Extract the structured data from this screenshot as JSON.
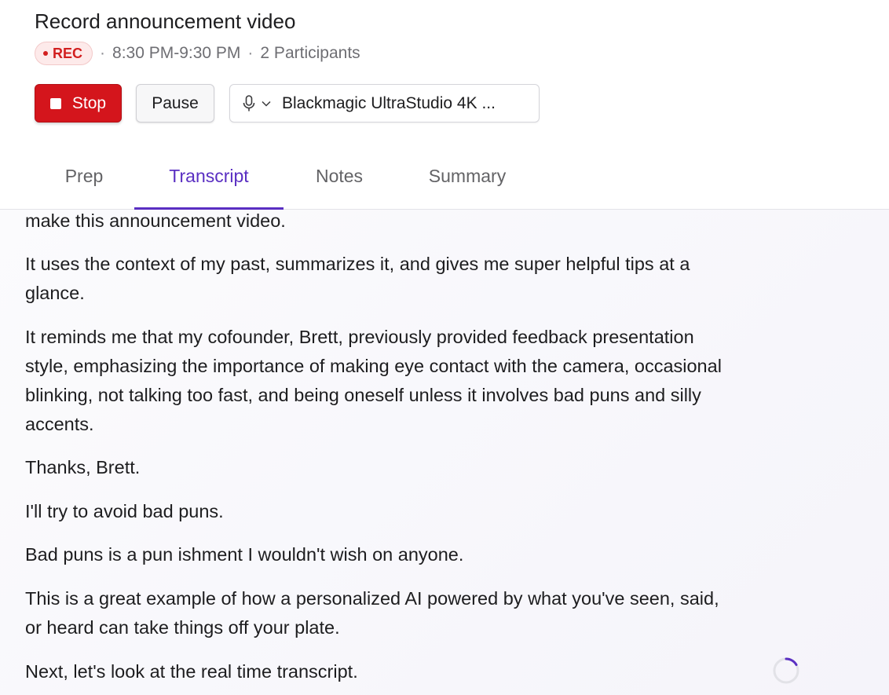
{
  "header": {
    "title": "Record announcement video",
    "rec_label": "REC",
    "time_range": "8:30 PM-9:30 PM",
    "separator": "·",
    "participants": "2 Participants"
  },
  "controls": {
    "stop_label": "Stop",
    "pause_label": "Pause",
    "mic_device": "Blackmagic UltraStudio 4K ..."
  },
  "tabs": [
    {
      "label": "Prep",
      "active": false
    },
    {
      "label": "Transcript",
      "active": true
    },
    {
      "label": "Notes",
      "active": false
    },
    {
      "label": "Summary",
      "active": false
    }
  ],
  "transcript": {
    "paragraphs": [
      "make this announcement video.",
      "It uses the context of my past, summarizes it, and gives me super helpful tips at a glance.",
      "It reminds me that my cofounder, Brett, previously provided feedback presentation style, emphasizing the importance of making eye contact with the camera, occasional blinking, not talking too fast, and being oneself unless it involves bad puns and silly accents.",
      "Thanks, Brett.",
      "I'll try to avoid bad puns.",
      "Bad puns is a pun ishment I wouldn't wish on anyone.",
      "This is a great example of how a personalized AI powered by what you've seen, said, or heard can take things off your plate.",
      "Next, let's look at the real time transcript."
    ]
  },
  "colors": {
    "accent": "#5a2fc2",
    "rec_red": "#d21f1f",
    "stop_red": "#d4151c"
  },
  "icons": {
    "record": "record-dot-icon",
    "stop": "stop-square-icon",
    "mic": "microphone-icon",
    "chevron": "chevron-down-icon",
    "loading": "loading-spinner-icon"
  }
}
